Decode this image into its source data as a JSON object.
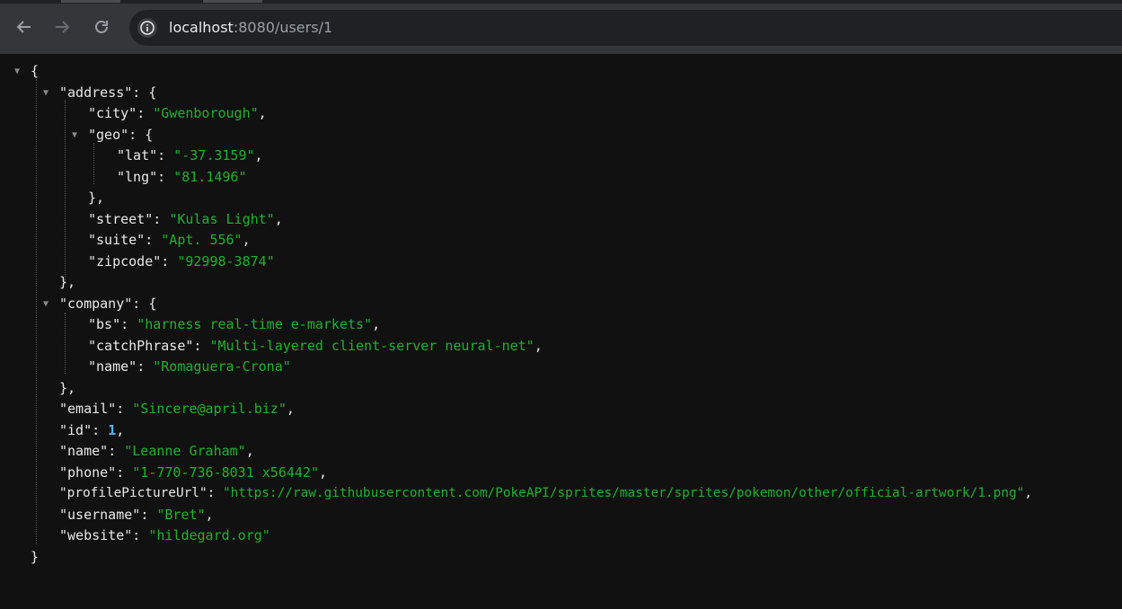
{
  "browser": {
    "url_host": "localhost",
    "url_rest": ":8080/users/1"
  },
  "json_viewer": {
    "address": {
      "key": "\"address\"",
      "city": {
        "key": "\"city\"",
        "value": "\"Gwenborough\""
      },
      "geo": {
        "key": "\"geo\"",
        "lat": {
          "key": "\"lat\"",
          "value": "\"-37.3159\""
        },
        "lng": {
          "key": "\"lng\"",
          "value": "\"81.1496\""
        }
      },
      "street": {
        "key": "\"street\"",
        "value": "\"Kulas Light\""
      },
      "suite": {
        "key": "\"suite\"",
        "value": "\"Apt. 556\""
      },
      "zipcode": {
        "key": "\"zipcode\"",
        "value": "\"92998-3874\""
      }
    },
    "company": {
      "key": "\"company\"",
      "bs": {
        "key": "\"bs\"",
        "value": "\"harness real-time e-markets\""
      },
      "catchPhrase": {
        "key": "\"catchPhrase\"",
        "value": "\"Multi-layered client-server neural-net\""
      },
      "name": {
        "key": "\"name\"",
        "value": "\"Romaguera-Crona\""
      }
    },
    "email": {
      "key": "\"email\"",
      "value": "\"Sincere@april.biz\""
    },
    "id": {
      "key": "\"id\"",
      "value": "1"
    },
    "name": {
      "key": "\"name\"",
      "value": "\"Leanne Graham\""
    },
    "phone": {
      "key": "\"phone\"",
      "value": "\"1-770-736-8031 x56442\""
    },
    "profilePictureUrl": {
      "key": "\"profilePictureUrl\"",
      "value": "\"https://raw.githubusercontent.com/PokeAPI/sprites/master/sprites/pokemon/other/official-artwork/1.png\""
    },
    "username": {
      "key": "\"username\"",
      "value": "\"Bret\""
    },
    "website": {
      "key": "\"website\"",
      "value": "\"hildegard.org\""
    }
  },
  "punct": {
    "open_brace": "{",
    "close_brace": "}",
    "close_brace_comma": "},",
    "colon": ": ",
    "comma": ","
  },
  "icons": {
    "toggle": "expand-toggle-icon",
    "back": "back-arrow-icon",
    "forward": "forward-arrow-icon",
    "reload": "reload-icon",
    "info": "info-icon"
  }
}
